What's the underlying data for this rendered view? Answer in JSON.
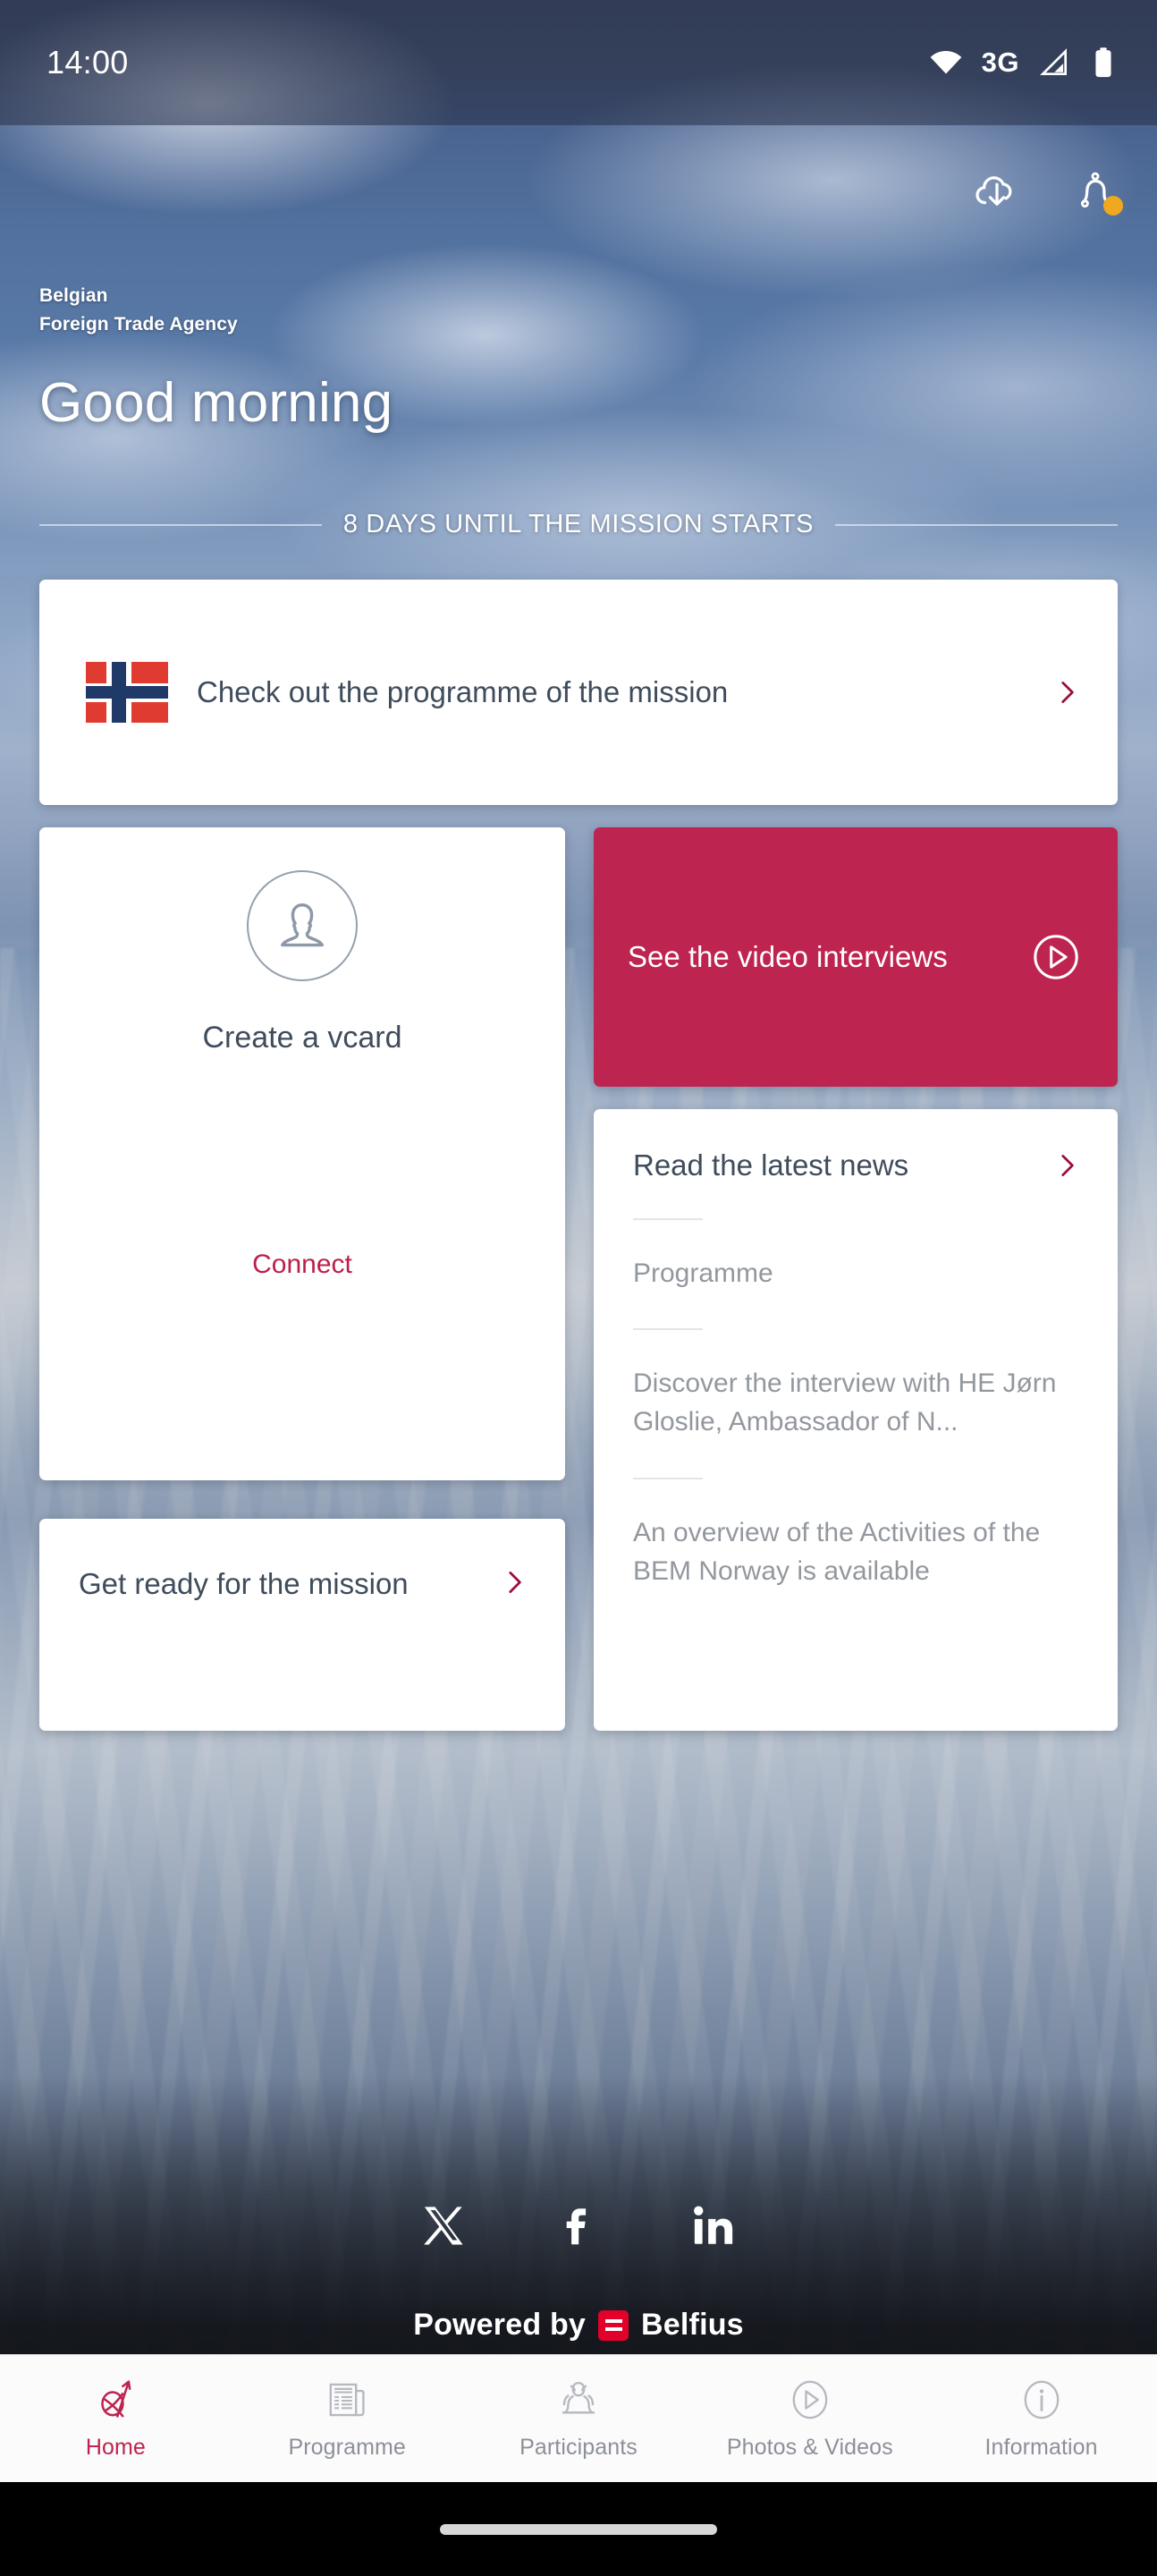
{
  "status_bar": {
    "clock": "14:00",
    "network_label": "3G",
    "icons": [
      "wifi-icon",
      "signal-icon",
      "battery-icon"
    ]
  },
  "top_actions": [
    {
      "name": "cloud-download-icon",
      "label": "Download"
    },
    {
      "name": "notifications-bell-icon",
      "label": "Notifications",
      "badge": true,
      "badge_color": "#F0A81E"
    }
  ],
  "header": {
    "brand_line1": "Belgian",
    "brand_line2": "Foreign Trade Agency",
    "greeting": "Good morning",
    "countdown": "8 DAYS UNTIL THE MISSION STARTS"
  },
  "programme_card": {
    "title": "Check out the programme of the mission",
    "flag": "norway-flag",
    "chevron_color": "#9B0E37"
  },
  "vcard_card": {
    "title": "Create a vcard",
    "action": "Connect",
    "action_color": "#BE1E4B",
    "avatar_icon": "person-avatar-icon"
  },
  "video_card": {
    "title": "See the video interviews",
    "background": "#BE2450",
    "icon": "play-circle-icon"
  },
  "news_card": {
    "title": "Read the latest news",
    "items": [
      "Programme",
      "Discover the interview with HE Jørn Gloslie, Ambassador of N...",
      "An overview of the Activities of the BEM Norway is available"
    ]
  },
  "ready_card": {
    "title": "Get ready for the mission"
  },
  "footer": {
    "socials": [
      {
        "name": "x-twitter-icon",
        "label": "X"
      },
      {
        "name": "facebook-icon",
        "label": "Facebook"
      },
      {
        "name": "linkedin-icon",
        "label": "LinkedIn"
      }
    ],
    "powered_by": "Powered by",
    "sponsor": "Belfius",
    "sponsor_color": "#E3002B"
  },
  "bottom_nav": {
    "active_color": "#BE2450",
    "items": [
      {
        "label": "Home",
        "icon": "globe-arrow-icon",
        "active": true
      },
      {
        "label": "Programme",
        "icon": "newspaper-icon",
        "active": false
      },
      {
        "label": "Participants",
        "icon": "people-group-icon",
        "active": false
      },
      {
        "label": "Photos & Videos",
        "icon": "play-circle-icon",
        "active": false
      },
      {
        "label": "Information",
        "icon": "info-circle-icon",
        "active": false
      }
    ]
  }
}
